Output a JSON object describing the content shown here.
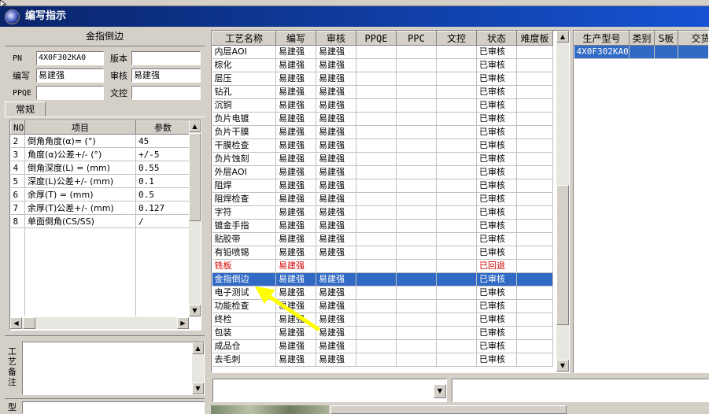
{
  "window": {
    "title": "编写指示"
  },
  "left_panel": {
    "header": "金指倒边",
    "fields": {
      "pn_label": "PN",
      "pn_value": "4X0F302KA0",
      "version_label": "版本",
      "version_value": "",
      "writer_label": "编写",
      "writer_value": "易建强",
      "reviewer_label": "审核",
      "reviewer_value": "易建强",
      "ppqe_label": "PPQE",
      "ppqe_value": "",
      "doc_control_label": "文控",
      "doc_control_value": ""
    },
    "tab_label": "常规",
    "param_table": {
      "headers": [
        "NO",
        "项目",
        "参数"
      ],
      "rows": [
        {
          "no": "2",
          "item": "倒角角度(α)=  (°)",
          "value": "45"
        },
        {
          "no": "3",
          "item": "角度(α)公差+/-  (°)",
          "value": "+/-5"
        },
        {
          "no": "4",
          "item": "倒角深度(L) =  (mm)",
          "value": "0.55"
        },
        {
          "no": "5",
          "item": "深度(L)公差+/-  (mm)",
          "value": "0.1"
        },
        {
          "no": "6",
          "item": "余厚(T) =  (mm)",
          "value": "0.5"
        },
        {
          "no": "7",
          "item": "余厚(T)公差+/-  (mm)",
          "value": "0.127"
        },
        {
          "no": "8",
          "item": "单面倒角(CS/SS)",
          "value": "/"
        }
      ]
    },
    "remarks_label": "工艺备注",
    "bottom_label": "型"
  },
  "process_grid": {
    "headers": [
      "工艺名称",
      "编写",
      "审核",
      "PPQE",
      "PPC",
      "文控",
      "状态",
      "难度板"
    ],
    "rows": [
      {
        "name": "内层AOI",
        "writer": "易建强",
        "reviewer": "易建强",
        "ppqe": "",
        "ppc": "",
        "doc": "",
        "status": "已审核",
        "difficulty": ""
      },
      {
        "name": "棕化",
        "writer": "易建强",
        "reviewer": "易建强",
        "ppqe": "",
        "ppc": "",
        "doc": "",
        "status": "已审核",
        "difficulty": ""
      },
      {
        "name": "层压",
        "writer": "易建强",
        "reviewer": "易建强",
        "ppqe": "",
        "ppc": "",
        "doc": "",
        "status": "已审核",
        "difficulty": ""
      },
      {
        "name": "钻孔",
        "writer": "易建强",
        "reviewer": "易建强",
        "ppqe": "",
        "ppc": "",
        "doc": "",
        "status": "已审核",
        "difficulty": ""
      },
      {
        "name": "沉铜",
        "writer": "易建强",
        "reviewer": "易建强",
        "ppqe": "",
        "ppc": "",
        "doc": "",
        "status": "已审核",
        "difficulty": ""
      },
      {
        "name": "负片电镀",
        "writer": "易建强",
        "reviewer": "易建强",
        "ppqe": "",
        "ppc": "",
        "doc": "",
        "status": "已审核",
        "difficulty": ""
      },
      {
        "name": "负片干膜",
        "writer": "易建强",
        "reviewer": "易建强",
        "ppqe": "",
        "ppc": "",
        "doc": "",
        "status": "已审核",
        "difficulty": ""
      },
      {
        "name": "干膜检查",
        "writer": "易建强",
        "reviewer": "易建强",
        "ppqe": "",
        "ppc": "",
        "doc": "",
        "status": "已审核",
        "difficulty": ""
      },
      {
        "name": "负片蚀刻",
        "writer": "易建强",
        "reviewer": "易建强",
        "ppqe": "",
        "ppc": "",
        "doc": "",
        "status": "已审核",
        "difficulty": ""
      },
      {
        "name": "外层AOI",
        "writer": "易建强",
        "reviewer": "易建强",
        "ppqe": "",
        "ppc": "",
        "doc": "",
        "status": "已审核",
        "difficulty": ""
      },
      {
        "name": "阻焊",
        "writer": "易建强",
        "reviewer": "易建强",
        "ppqe": "",
        "ppc": "",
        "doc": "",
        "status": "已审核",
        "difficulty": ""
      },
      {
        "name": "阻焊检查",
        "writer": "易建强",
        "reviewer": "易建强",
        "ppqe": "",
        "ppc": "",
        "doc": "",
        "status": "已审核",
        "difficulty": ""
      },
      {
        "name": "字符",
        "writer": "易建强",
        "reviewer": "易建强",
        "ppqe": "",
        "ppc": "",
        "doc": "",
        "status": "已审核",
        "difficulty": ""
      },
      {
        "name": "镀金手指",
        "writer": "易建强",
        "reviewer": "易建强",
        "ppqe": "",
        "ppc": "",
        "doc": "",
        "status": "已审核",
        "difficulty": ""
      },
      {
        "name": "贴胶带",
        "writer": "易建强",
        "reviewer": "易建强",
        "ppqe": "",
        "ppc": "",
        "doc": "",
        "status": "已审核",
        "difficulty": ""
      },
      {
        "name": "有铅喷锡",
        "writer": "易建强",
        "reviewer": "易建强",
        "ppqe": "",
        "ppc": "",
        "doc": "",
        "status": "已审核",
        "difficulty": ""
      },
      {
        "name": "铣板",
        "writer": "易建强",
        "reviewer": "",
        "ppqe": "",
        "ppc": "",
        "doc": "",
        "status": "已回退",
        "difficulty": "",
        "style": "red"
      },
      {
        "name": "金指倒边",
        "writer": "易建强",
        "reviewer": "易建强",
        "ppqe": "",
        "ppc": "",
        "doc": "",
        "status": "已审核",
        "difficulty": "",
        "style": "sel"
      },
      {
        "name": "电子测试",
        "writer": "易建强",
        "reviewer": "易建强",
        "ppqe": "",
        "ppc": "",
        "doc": "",
        "status": "已审核",
        "difficulty": ""
      },
      {
        "name": "功能检查",
        "writer": "易建强",
        "reviewer": "易建强",
        "ppqe": "",
        "ppc": "",
        "doc": "",
        "status": "已审核",
        "difficulty": ""
      },
      {
        "name": "终检",
        "writer": "易建强",
        "reviewer": "易建强",
        "ppqe": "",
        "ppc": "",
        "doc": "",
        "status": "已审核",
        "difficulty": ""
      },
      {
        "name": "包装",
        "writer": "易建强",
        "reviewer": "易建强",
        "ppqe": "",
        "ppc": "",
        "doc": "",
        "status": "已审核",
        "difficulty": ""
      },
      {
        "name": "成品仓",
        "writer": "易建强",
        "reviewer": "易建强",
        "ppqe": "",
        "ppc": "",
        "doc": "",
        "status": "已审核",
        "difficulty": ""
      },
      {
        "name": "去毛刺",
        "writer": "易建强",
        "reviewer": "易建强",
        "ppqe": "",
        "ppc": "",
        "doc": "",
        "status": "已审核",
        "difficulty": ""
      }
    ]
  },
  "right_panel": {
    "headers": [
      "生产型号",
      "类别",
      "S板",
      "交货"
    ],
    "rows": [
      {
        "model": "4X0F302KA0",
        "category": "",
        "s_board": "",
        "delivery": ""
      }
    ]
  },
  "bottom": {
    "dropdown_value": "",
    "text_value": ""
  },
  "colors": {
    "title_bar": "#0a246a",
    "selection": "#316ac5",
    "rejected_text": "#d40000",
    "arrow": "#ffff00"
  }
}
